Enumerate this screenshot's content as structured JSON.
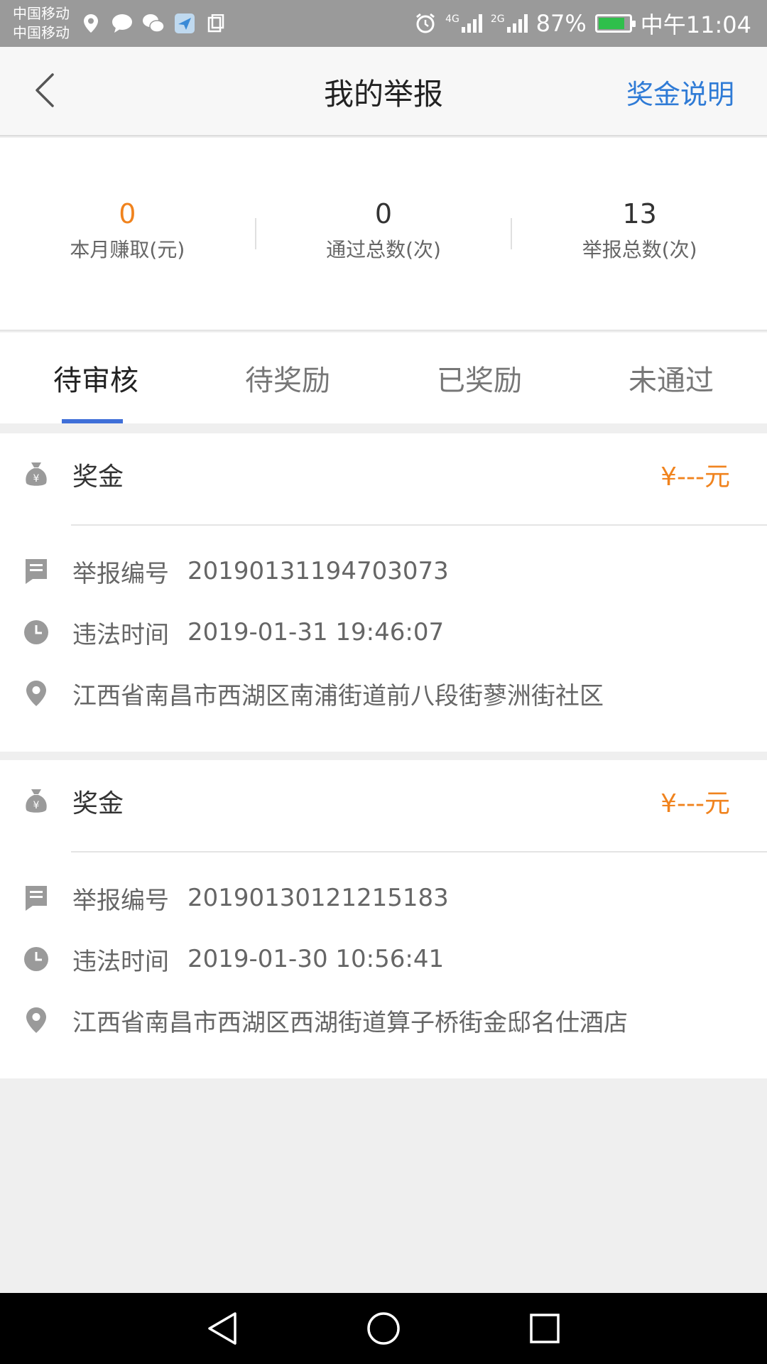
{
  "status_bar": {
    "carrier_1": "中国移动",
    "carrier_2": "中国移动",
    "net_1": "4G",
    "net_2": "2G",
    "battery_pct": "87%",
    "time": "中午11:04",
    "icons": [
      "location-icon",
      "message-icon",
      "wechat-icon",
      "app-icon",
      "clipboard-icon",
      "alarm-icon"
    ]
  },
  "header": {
    "title": "我的举报",
    "right_link": "奖金说明"
  },
  "stats": [
    {
      "value": "0",
      "label": "本月赚取(元)"
    },
    {
      "value": "0",
      "label": "通过总数(次)"
    },
    {
      "value": "13",
      "label": "举报总数(次)"
    }
  ],
  "tabs": [
    {
      "label": "待审核",
      "active": true
    },
    {
      "label": "待奖励",
      "active": false
    },
    {
      "label": "已奖励",
      "active": false
    },
    {
      "label": "未通过",
      "active": false
    }
  ],
  "reports": [
    {
      "bonus_label": "奖金",
      "bonus_amount": "¥---元",
      "id_label": "举报编号",
      "id_value": "20190131194703073",
      "time_label": "违法时间",
      "time_value": "2019-01-31 19:46:07",
      "address": "江西省南昌市西湖区南浦街道前八段街蓼洲街社区"
    },
    {
      "bonus_label": "奖金",
      "bonus_amount": "¥---元",
      "id_label": "举报编号",
      "id_value": "20190130121215183",
      "time_label": "违法时间",
      "time_value": "2019-01-30 10:56:41",
      "address": "江西省南昌市西湖区西湖街道算子桥街金邸名仕酒店"
    }
  ],
  "colors": {
    "accent_orange": "#f0831e",
    "link_blue": "#2f7bd6",
    "tab_indicator": "#3f6fd8",
    "icon_gray": "#9a9a9a"
  }
}
